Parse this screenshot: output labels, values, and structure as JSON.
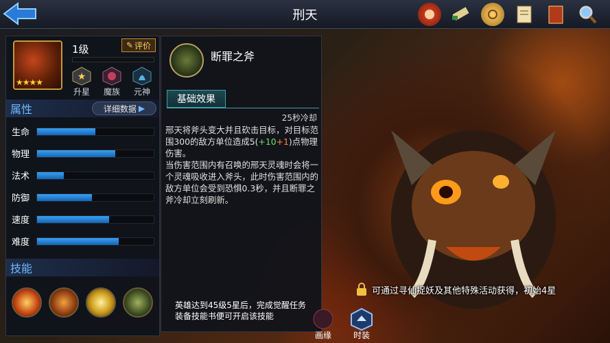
{
  "header": {
    "title": "刑天"
  },
  "top_icons": [
    "menu-scroll-icon",
    "scroll-icon",
    "coin-icon",
    "notice-icon",
    "book-icon",
    "magnifier-icon"
  ],
  "hero": {
    "level": "1级",
    "rate_label": "评价",
    "star_count": 4,
    "tags": [
      {
        "label": "升星",
        "icon": "star-badge-icon"
      },
      {
        "label": "魔族",
        "icon": "demon-badge-icon"
      },
      {
        "label": "元神",
        "icon": "spirit-badge-icon"
      }
    ]
  },
  "attributes": {
    "title": "属性",
    "detail_label": "详细数据",
    "stats": [
      {
        "name": "生命",
        "value": 0.5
      },
      {
        "name": "物理",
        "value": 0.67
      },
      {
        "name": "法术",
        "value": 0.23
      },
      {
        "name": "防御",
        "value": 0.47
      },
      {
        "name": "速度",
        "value": 0.62
      },
      {
        "name": "难度",
        "value": 0.7
      }
    ]
  },
  "skills": {
    "title": "技能",
    "items": [
      "fire-slash-skill-icon",
      "beast-roar-skill-icon",
      "light-burst-skill-icon",
      "axe-skill-icon"
    ]
  },
  "skill_detail": {
    "name": "断罪之斧",
    "tab": "基础效果",
    "cooldown": "25秒冷却",
    "desc1": "邢天将斧头变大并且砍击目标，对目标范围300的敌方单位造成5(",
    "desc1_green": "+10",
    "desc1_orange": "+1",
    "desc1_end": ")点物理伤害。",
    "desc2": "当伤害范围内有召唤的邢天灵魂时会将一个灵魂吸收进入斧头，此时伤害范围内的敌方单位会受到恐惧0.3秒，并且断罪之斧冷却立刻刷新。",
    "note": "英雄达到45级5星后，完成觉醒任务装备技能书便可开启该技能"
  },
  "bottom_tabs": [
    {
      "label": "画缘"
    },
    {
      "label": "时装"
    }
  ],
  "obtain": "可通过寻仙捉妖及其他特殊活动获得，初始4星",
  "colors": {
    "accent": "#6fb8ff",
    "bar": "#2a8ae0",
    "gold": "#c79a3a"
  }
}
